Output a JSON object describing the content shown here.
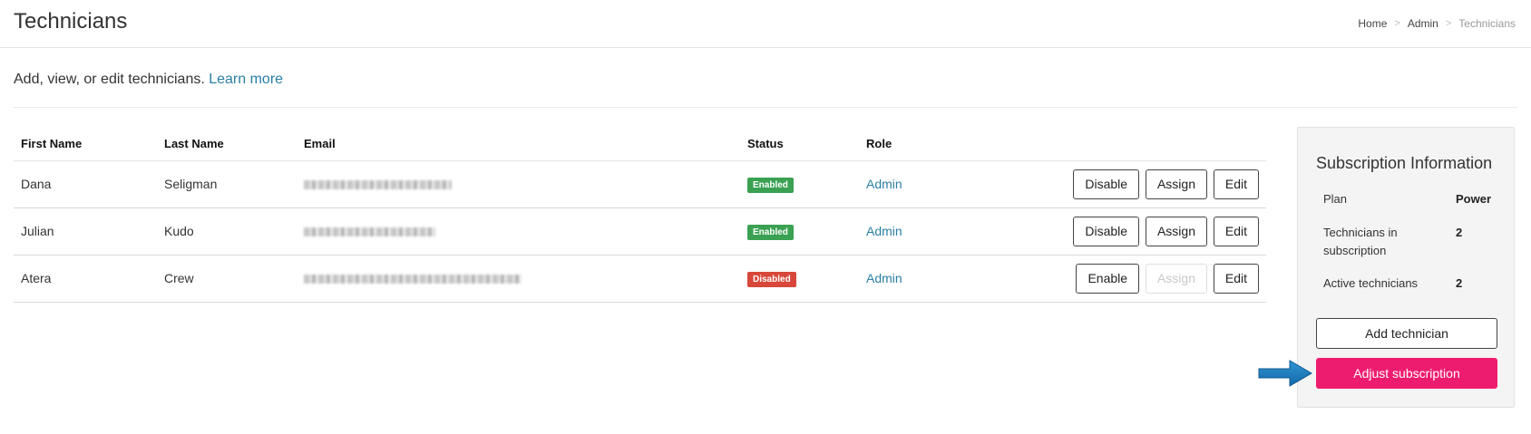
{
  "header": {
    "title": "Technicians",
    "breadcrumb": {
      "items": [
        "Home",
        "Admin",
        "Technicians"
      ],
      "separator": ">"
    }
  },
  "intro": {
    "text": "Add, view, or edit technicians.",
    "link_label": "Learn more"
  },
  "table": {
    "columns": [
      "First Name",
      "Last Name",
      "Email",
      "Status",
      "Role"
    ],
    "rows": [
      {
        "first_name": "Dana",
        "last_name": "Seligman",
        "email_obscured": true,
        "status": "Enabled",
        "role": "Admin",
        "actions": [
          "Disable",
          "Assign",
          "Edit"
        ]
      },
      {
        "first_name": "Julian",
        "last_name": "Kudo",
        "email_obscured": true,
        "status": "Enabled",
        "role": "Admin",
        "actions": [
          "Disable",
          "Assign",
          "Edit"
        ]
      },
      {
        "first_name": "Atera",
        "last_name": "Crew",
        "email_obscured": true,
        "status": "Disabled",
        "role": "Admin",
        "actions": [
          "Enable",
          "Assign",
          "Edit"
        ]
      }
    ]
  },
  "subscription": {
    "title": "Subscription Information",
    "plan_label": "Plan",
    "plan_value": "Power",
    "technicians_label_line1": "Technicians in",
    "technicians_label_line2": "subscription",
    "technicians_value": "2",
    "active_label": "Active technicians",
    "active_value": "2",
    "add_button": "Add technician",
    "adjust_button": "Adjust subscription"
  },
  "colors": {
    "link": "#2a7fa5",
    "badge_enabled": "#3aa152",
    "badge_disabled": "#d8483a",
    "primary_button": "#ee1c6f",
    "arrow": "#1a7fc1"
  },
  "icons": {
    "annotation": "arrow-right-icon"
  }
}
